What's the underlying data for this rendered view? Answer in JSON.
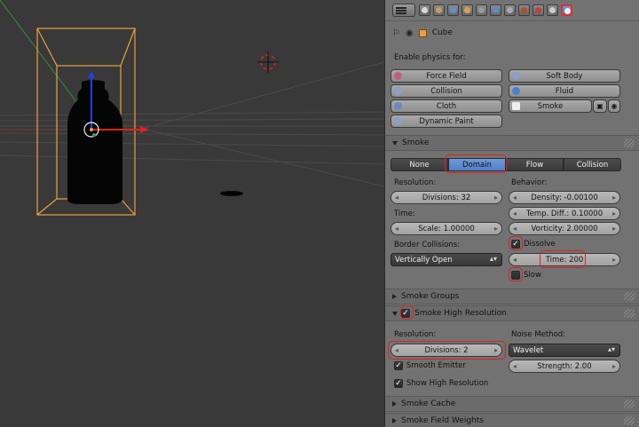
{
  "header": {
    "context_object": "Cube"
  },
  "icons": {
    "menu": "editor-type-menu-icon",
    "pin": "pin-icon",
    "scene": "scene-icon",
    "cube": "cube-icon"
  },
  "physics": {
    "title": "Enable physics for:",
    "buttons": {
      "force_field": "Force Field",
      "soft_body": "Soft Body",
      "collision": "Collision",
      "fluid": "Fluid",
      "cloth": "Cloth",
      "smoke": "Smoke",
      "dynamic_paint": "Dynamic Paint"
    }
  },
  "smoke": {
    "title": "Smoke",
    "types": [
      "None",
      "Domain",
      "Flow",
      "Collision"
    ],
    "active_type": "Domain",
    "resolution_label": "Resolution:",
    "divisions": "Divisions: 32",
    "time_label": "Time:",
    "scale": "Scale: 1.00000",
    "border_label": "Border Collisions:",
    "border_value": "Vertically Open",
    "behavior_label": "Behavior:",
    "density": "Density: -0.00100",
    "temp_diff": "Temp. Diff.: 0.10000",
    "vorticity": "Vorticity: 2.00000",
    "dissolve_label": "Dissolve",
    "dissolve_checked": true,
    "time": "Time: 200",
    "slow_label": "Slow",
    "slow_checked": false
  },
  "smoke_groups": {
    "title": "Smoke Groups"
  },
  "smoke_high_res": {
    "title": "Smoke High Resolution",
    "enabled": true,
    "resolution_label": "Resolution:",
    "divisions": "Divisions: 2",
    "noise_label": "Noise Method:",
    "noise_value": "Wavelet",
    "smooth_emitter": "Smooth Emitter",
    "strength": "Strength: 2.00",
    "show_high_res": "Show High Resolution"
  },
  "smoke_cache": {
    "title": "Smoke Cache"
  },
  "smoke_field_weights": {
    "title": "Smoke Field Weights"
  }
}
